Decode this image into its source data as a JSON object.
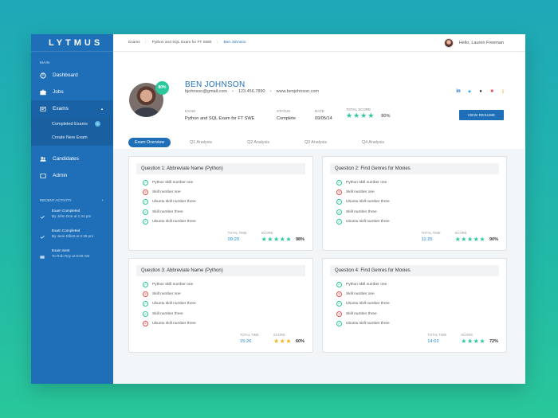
{
  "app": {
    "logo": "LYTMUS"
  },
  "sidebar": {
    "main_label": "MAIN",
    "items": [
      {
        "label": "Dashboard",
        "icon": "dashboard-icon"
      },
      {
        "label": "Jobs",
        "icon": "briefcase-icon"
      },
      {
        "label": "Exams",
        "icon": "exam-icon"
      },
      {
        "label": "Candidates",
        "icon": "users-icon"
      },
      {
        "label": "Admin",
        "icon": "admin-icon"
      }
    ],
    "exams_sub": [
      {
        "label": "Completed Exams",
        "badge": "5"
      },
      {
        "label": "Create New Exam"
      }
    ],
    "activity_label": "RECENT ACTIVITY",
    "activity_toggle": "+",
    "activity": [
      {
        "title": "Exam Completed",
        "sub": "By John Doe at 1:44 pm"
      },
      {
        "title": "Exam Completed",
        "sub": "By Jane Elliott at 2:39 pm"
      },
      {
        "title": "Exam Sent",
        "sub": "To Rob Roy at 8:00 AM"
      }
    ]
  },
  "topbar": {
    "breadcrumb": [
      "Exams",
      "Python and SQL Exam for FT SWE",
      "Ben Johnson"
    ],
    "greeting": "Hello, Lauren Freeman"
  },
  "profile": {
    "badge": "80%",
    "name": "BEN JOHNSON",
    "email": "bjohnson@gmail.com",
    "phone": "123.456.7890",
    "website": "www.benjohnson.com",
    "exam_label": "EXAM",
    "exam": "Python and SQL Exam for FT SWE",
    "status_label": "STATUS",
    "status": "Complete",
    "date_label": "DATE",
    "date": "09/05/14",
    "score_label": "TOTAL SCORE",
    "score_stars": 4,
    "score": "80%",
    "resume_button": "VIEW RESUME"
  },
  "tabs": [
    "Exam Overview",
    "Q1 Analysis",
    "Q2 Analysis",
    "Q3 Analysis",
    "Q4 Analysis"
  ],
  "cards": [
    {
      "title": "Question 1:  Abbreviate Name (Python)",
      "items": [
        {
          "label": "Python skill number one",
          "ok": true
        },
        {
          "label": "Skill number one",
          "ok": false
        },
        {
          "label": "Ubuntu skill number three",
          "ok": true
        },
        {
          "label": "Skill number three",
          "ok": true
        },
        {
          "label": "Ubuntu skill number three",
          "ok": true
        }
      ],
      "time_label": "TOTAL TIME",
      "time": "09:20",
      "score_label": "SCORE",
      "stars": 5,
      "star_color": "teal",
      "score": "98%"
    },
    {
      "title": "Question 2:  Find Genres for Movies",
      "items": [
        {
          "label": "Python skill number one",
          "ok": true
        },
        {
          "label": "Skill number one",
          "ok": false
        },
        {
          "label": "Ubuntu skill number three",
          "ok": true
        },
        {
          "label": "Skill number three",
          "ok": true
        },
        {
          "label": "Ubuntu skill number three",
          "ok": true
        }
      ],
      "time_label": "TOTAL TIME",
      "time": "11:25",
      "score_label": "SCORE",
      "stars": 5,
      "star_color": "teal",
      "score": "90%"
    },
    {
      "title": "Question 3:  Abbreviate Name (Python)",
      "items": [
        {
          "label": "Python skill number one",
          "ok": true
        },
        {
          "label": "Skill number one",
          "ok": false
        },
        {
          "label": "Ubuntu skill number three",
          "ok": true
        },
        {
          "label": "Skill number three",
          "ok": true
        },
        {
          "label": "Ubuntu skill number three",
          "ok": false
        }
      ],
      "time_label": "TOTAL TIME",
      "time": "15:26",
      "score_label": "SCORE",
      "stars": 3,
      "star_color": "gold",
      "score": "60%"
    },
    {
      "title": "Question 4:  Find Genres for Movies",
      "items": [
        {
          "label": "Python skill number one",
          "ok": true
        },
        {
          "label": "Skill number one",
          "ok": false
        },
        {
          "label": "Ubuntu skill number three",
          "ok": true
        },
        {
          "label": "Skill number three",
          "ok": false
        },
        {
          "label": "Ubuntu skill number three",
          "ok": true
        }
      ],
      "time_label": "TOTAL TIME",
      "time": "14:02",
      "score_label": "SCORE",
      "stars": 4,
      "star_color": "teal",
      "score": "72%"
    }
  ],
  "colors": {
    "primary": "#1e6fb8",
    "accent": "#2cc79c",
    "error": "#e2514c",
    "gold": "#f2b21e"
  }
}
